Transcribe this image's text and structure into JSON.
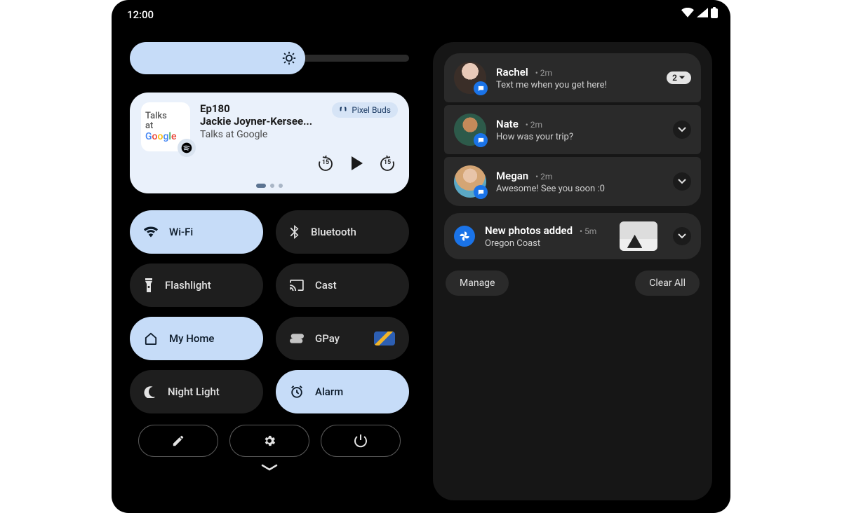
{
  "status": {
    "time": "12:00"
  },
  "brightness": {
    "level_pct": 63
  },
  "media": {
    "art_line1": "Talks",
    "art_line2": "at",
    "art_google": "Google",
    "title_line1": "Ep180",
    "title_line2": "Jackie Joyner-Kersee...",
    "subtitle": "Talks at Google",
    "output_device": "Pixel Buds",
    "skip_back_sec": "15",
    "skip_fwd_sec": "15"
  },
  "tiles": {
    "wifi": "Wi-Fi",
    "bluetooth": "Bluetooth",
    "flashlight": "Flashlight",
    "cast": "Cast",
    "home": "My Home",
    "gpay": "GPay",
    "nightlight": "Night Light",
    "alarm": "Alarm"
  },
  "notifications": {
    "messages": [
      {
        "sender": "Rachel",
        "age": "2m",
        "body": "Text me when you get here!",
        "count": "2"
      },
      {
        "sender": "Nate",
        "age": "2m",
        "body": "How was your trip?"
      },
      {
        "sender": "Megan",
        "age": "2m",
        "body": "Awesome! See you soon :0"
      }
    ],
    "photos": {
      "title": "New photos added",
      "age": "5m",
      "body": "Oregon Coast"
    },
    "manage_label": "Manage",
    "clear_label": "Clear All"
  }
}
